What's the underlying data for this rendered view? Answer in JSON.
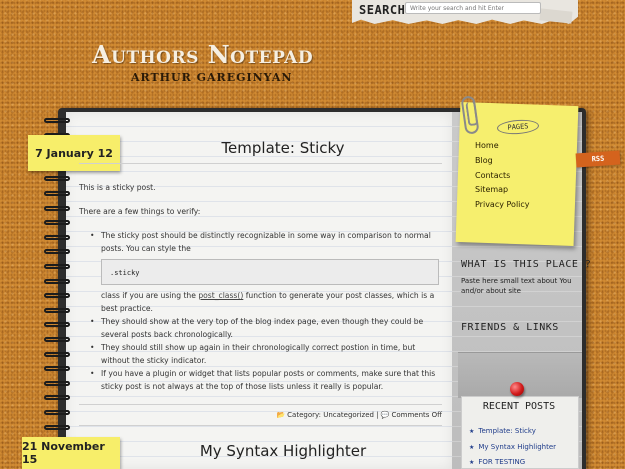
{
  "search": {
    "label": "SEARCH",
    "placeholder": "Write your search and hit Enter"
  },
  "site": {
    "title": "Authors Notepad",
    "subtitle": "ARTHUR GAREGINYAN"
  },
  "posts": [
    {
      "date": "7 January 12",
      "title": "Template: Sticky",
      "intro": "This is a sticky post.",
      "verify_text": "There are a few things to verify:",
      "item1_text": "The sticky post should be distinctly recognizable in some way in comparison to normal posts. You can style the",
      "code": ".sticky",
      "item1_after_before_link": "class if you are using the ",
      "item1_link": "post_class()",
      "item1_after_link": " function to generate your post classes, which is a best practice.",
      "item2": "They should show at the very top of the blog index page, even though they could be several posts back chronologically.",
      "item3": "They should still show up again in their chronologically correct postion in time, but without the sticky indicator.",
      "item4": "If you have a plugin or widget that lists popular posts or comments, make sure that this sticky post is not always at the top of those lists unless it really is popular.",
      "category_label": "Category: ",
      "category": "Uncategorized",
      "separator": " | ",
      "comments": "Comments Off"
    },
    {
      "date": "21 November 15",
      "title": "My Syntax Highlighter"
    }
  ],
  "sidebar": {
    "pages_title": "PAGES",
    "pages": [
      "Home",
      "Blog",
      "Contacts",
      "Sitemap",
      "Privacy Policy"
    ],
    "rss": "RSS",
    "about_title": "WHAT IS THIS PLACE ?",
    "about_text": "Paste here small text about You and/or about site",
    "friends_title": "FRIENDS & LINKS",
    "recent_title": "RECENT POSTS",
    "recent": [
      "Template: Sticky",
      "My Syntax Highlighter",
      "FOR TESTING"
    ]
  },
  "colors": {
    "cork": "#d08a32",
    "sticky_yellow": "#f7ee6a",
    "recent_link": "#1f3c8a"
  }
}
